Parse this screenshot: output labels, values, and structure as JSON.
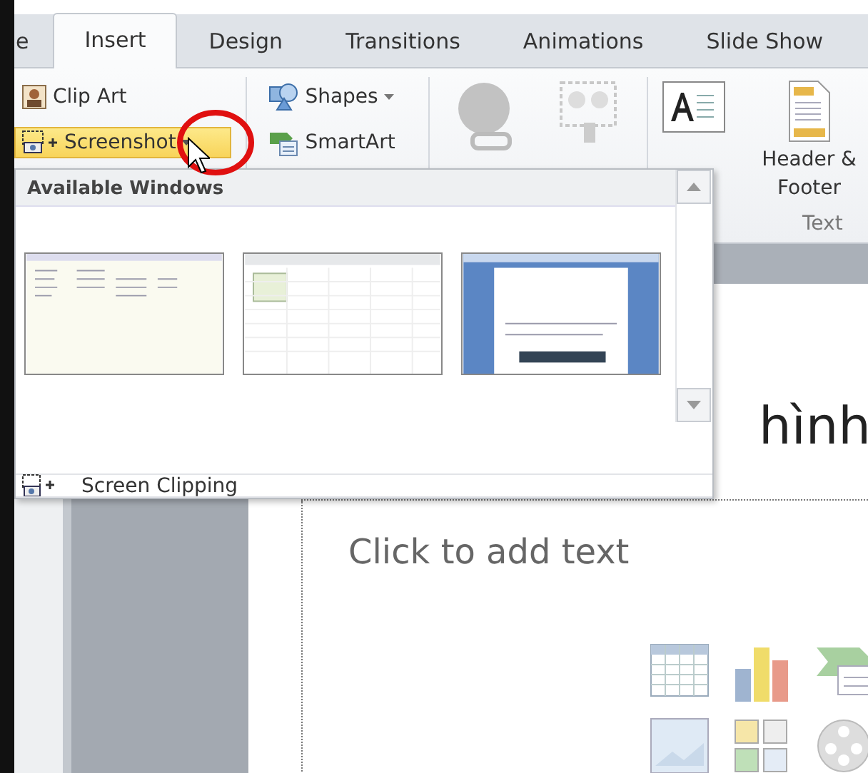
{
  "tabs": [
    {
      "label": "e",
      "selected": false
    },
    {
      "label": "Insert",
      "selected": true
    },
    {
      "label": "Design",
      "selected": false
    },
    {
      "label": "Transitions",
      "selected": false
    },
    {
      "label": "Animations",
      "selected": false
    },
    {
      "label": "Slide Show",
      "selected": false
    }
  ],
  "ribbon": {
    "images_items": [
      {
        "label": "Clip Art",
        "highlighted": false,
        "has_caret": false
      },
      {
        "label": "Screenshot",
        "highlighted": true,
        "has_caret": true
      }
    ],
    "illustrations_items": [
      {
        "label": "Shapes",
        "has_caret": true
      },
      {
        "label": "SmartArt",
        "has_caret": false
      }
    ],
    "text_group": {
      "button": "Header & Footer",
      "group_label": "Text"
    }
  },
  "dropdown": {
    "title": "Available Windows",
    "footer_item": "Screen Clipping"
  },
  "slide": {
    "title": "hình",
    "body_placeholder": "Click to add text"
  }
}
